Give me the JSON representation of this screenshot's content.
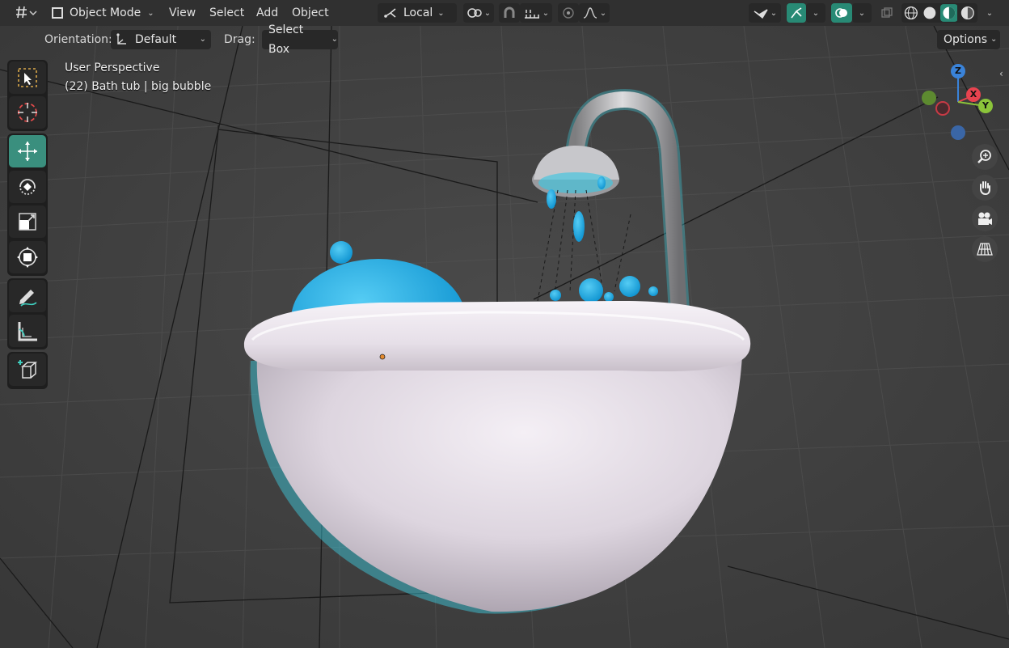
{
  "topbar": {
    "mode_label": "Object Mode",
    "menus": [
      "View",
      "Select",
      "Add",
      "Object"
    ],
    "transform_space_label": "Local"
  },
  "header": {
    "orientation_label": "Orientation:",
    "orientation_value": "Default",
    "drag_label": "Drag:",
    "drag_value": "Select Box",
    "options_label": "Options"
  },
  "viewport": {
    "view_name": "User Perspective",
    "object_info": "(22) Bath tub | big bubble"
  },
  "gizmo": {
    "z": "Z",
    "x": "X",
    "y": "Y"
  },
  "tools": [
    "select-box",
    "cursor",
    "move",
    "rotate",
    "scale",
    "transform",
    "annotate",
    "measure",
    "add-cube"
  ],
  "colors": {
    "accent": "#288a75",
    "header_bg": "#303030",
    "viewport_bg": "#3f3f3f",
    "water": "#1aa8e0",
    "tub": "#e8e4ea",
    "axis_x": "#e8434f",
    "axis_y": "#8bc43a",
    "axis_z": "#3a83d9"
  }
}
